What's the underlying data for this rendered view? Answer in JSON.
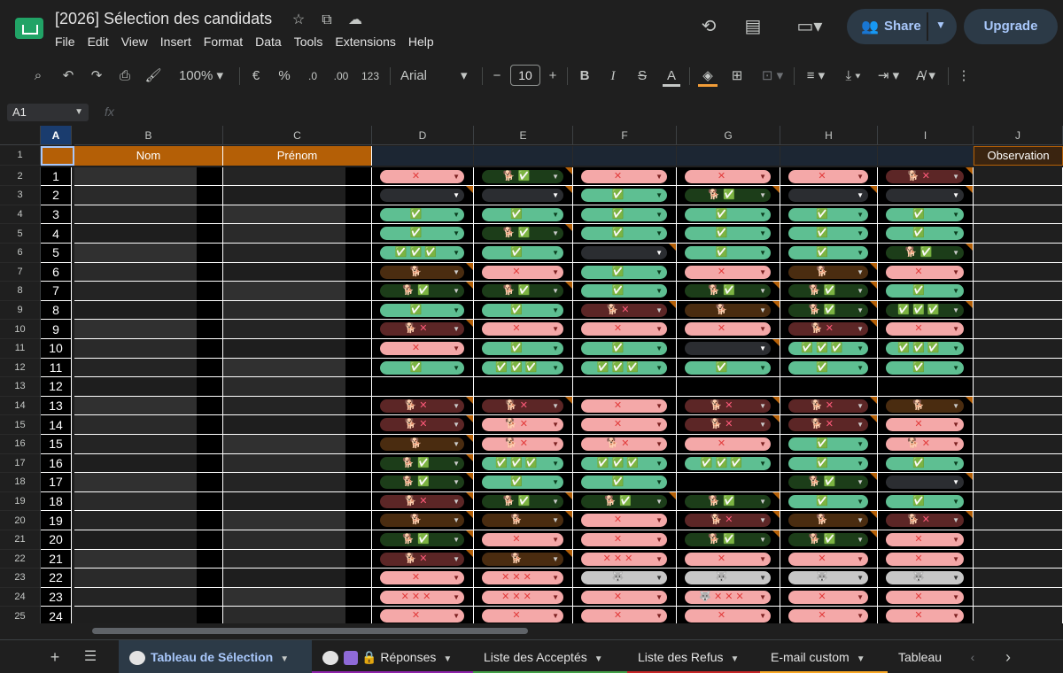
{
  "header": {
    "doc_title": "[2026] Sélection des candidats",
    "menu": [
      "File",
      "Edit",
      "View",
      "Insert",
      "Format",
      "Data",
      "Tools",
      "Extensions",
      "Help"
    ],
    "share_label": "Share",
    "upgrade_label": "Upgrade"
  },
  "toolbar": {
    "zoom": "100%",
    "currency": "€",
    "percent": "%",
    "dec_decrease": ".0",
    "dec_increase": ".00",
    "number_format": "123",
    "font_name": "Arial",
    "font_size": "10",
    "bold": "B",
    "italic": "I",
    "text_color_letter": "A"
  },
  "formula_bar": {
    "name_box": "A1",
    "fx": "fx",
    "content": ""
  },
  "columns": [
    "A",
    "B",
    "C",
    "D",
    "E",
    "F",
    "G",
    "H",
    "I",
    "J"
  ],
  "header_row": {
    "row_number": "1",
    "nom": "Nom",
    "prenom": "Prénom",
    "observation": "Observation"
  },
  "legend": {
    "G": "✓ (green chip)",
    "P": "✗ (pink chip)",
    "D": "dark green chip",
    "B": "brown chip",
    "M": "maroon chip",
    "K": "empty dark chip",
    "W": "grey chip"
  },
  "rows": [
    {
      "row": "2",
      "a": "1",
      "d": {
        "t": "P",
        "v": "✕"
      },
      "e": {
        "t": "D",
        "v": "🐕 ✅"
      },
      "f": {
        "t": "P",
        "v": "✕"
      },
      "g": {
        "t": "P",
        "v": "✕"
      },
      "h": {
        "t": "P",
        "v": "✕"
      },
      "i": {
        "t": "M",
        "v": "🐕 ✕"
      }
    },
    {
      "row": "3",
      "a": "2",
      "d": {
        "t": "K",
        "v": ""
      },
      "e": {
        "t": "K",
        "v": ""
      },
      "f": {
        "t": "G",
        "v": "✅"
      },
      "g": {
        "t": "D",
        "v": "🐕 ✅"
      },
      "h": {
        "t": "K",
        "v": ""
      },
      "i": {
        "t": "K",
        "v": ""
      }
    },
    {
      "row": "4",
      "a": "3",
      "d": {
        "t": "G",
        "v": "✅"
      },
      "e": {
        "t": "G",
        "v": "✅"
      },
      "f": {
        "t": "G",
        "v": "✅"
      },
      "g": {
        "t": "G",
        "v": "✅"
      },
      "h": {
        "t": "G",
        "v": "✅"
      },
      "i": {
        "t": "G",
        "v": "✅"
      }
    },
    {
      "row": "5",
      "a": "4",
      "d": {
        "t": "G",
        "v": "✅"
      },
      "e": {
        "t": "D",
        "v": "🐕 ✅"
      },
      "f": {
        "t": "G",
        "v": "✅"
      },
      "g": {
        "t": "G",
        "v": "✅"
      },
      "h": {
        "t": "G",
        "v": "✅"
      },
      "i": {
        "t": "G",
        "v": "✅"
      }
    },
    {
      "row": "6",
      "a": "5",
      "d": {
        "t": "G",
        "v": "✅ ✅ ✅"
      },
      "e": {
        "t": "G",
        "v": "✅"
      },
      "f": {
        "t": "K",
        "v": ""
      },
      "g": {
        "t": "G",
        "v": "✅"
      },
      "h": {
        "t": "G",
        "v": "✅"
      },
      "i": {
        "t": "D",
        "v": "🐕 ✅"
      }
    },
    {
      "row": "7",
      "a": "6",
      "d": {
        "t": "B",
        "v": "🐕"
      },
      "e": {
        "t": "P",
        "v": "✕"
      },
      "f": {
        "t": "G",
        "v": "✅"
      },
      "g": {
        "t": "P",
        "v": "✕"
      },
      "h": {
        "t": "B",
        "v": "🐕"
      },
      "i": {
        "t": "P",
        "v": "✕"
      }
    },
    {
      "row": "8",
      "a": "7",
      "d": {
        "t": "D",
        "v": "🐕 ✅"
      },
      "e": {
        "t": "D",
        "v": "🐕 ✅"
      },
      "f": {
        "t": "G",
        "v": "✅"
      },
      "g": {
        "t": "D",
        "v": "🐕 ✅"
      },
      "h": {
        "t": "D",
        "v": "🐕 ✅"
      },
      "i": {
        "t": "G",
        "v": "✅"
      }
    },
    {
      "row": "9",
      "a": "8",
      "d": {
        "t": "G",
        "v": "✅"
      },
      "e": {
        "t": "G",
        "v": "✅"
      },
      "f": {
        "t": "M",
        "v": "🐕 ✕"
      },
      "g": {
        "t": "B",
        "v": "🐕"
      },
      "h": {
        "t": "D",
        "v": "🐕 ✅"
      },
      "i": {
        "t": "D",
        "v": "✅ ✅ ✅"
      }
    },
    {
      "row": "10",
      "a": "9",
      "d": {
        "t": "M",
        "v": "🐕 ✕"
      },
      "e": {
        "t": "P",
        "v": "✕"
      },
      "f": {
        "t": "P",
        "v": "✕"
      },
      "g": {
        "t": "P",
        "v": "✕"
      },
      "h": {
        "t": "M",
        "v": "🐕 ✕"
      },
      "i": {
        "t": "P",
        "v": "✕"
      }
    },
    {
      "row": "11",
      "a": "10",
      "d": {
        "t": "P",
        "v": "✕"
      },
      "e": {
        "t": "G",
        "v": "✅"
      },
      "f": {
        "t": "G",
        "v": "✅"
      },
      "g": {
        "t": "K",
        "v": ""
      },
      "h": {
        "t": "G",
        "v": "✅ ✅ ✅"
      },
      "i": {
        "t": "G",
        "v": "✅ ✅ ✅"
      }
    },
    {
      "row": "12",
      "a": "11",
      "d": {
        "t": "G",
        "v": "✅"
      },
      "e": {
        "t": "G",
        "v": "✅ ✅ ✅"
      },
      "f": {
        "t": "G",
        "v": "✅ ✅ ✅"
      },
      "g": {
        "t": "G",
        "v": "✅"
      },
      "h": {
        "t": "G",
        "v": "✅"
      },
      "i": {
        "t": "G",
        "v": "✅"
      }
    },
    {
      "row": "13",
      "a": "12",
      "d": null,
      "e": null,
      "f": null,
      "g": null,
      "h": null,
      "i": null
    },
    {
      "row": "14",
      "a": "13",
      "d": {
        "t": "M",
        "v": "🐕 ✕"
      },
      "e": {
        "t": "M",
        "v": "🐕 ✕"
      },
      "f": {
        "t": "P",
        "v": "✕"
      },
      "g": {
        "t": "M",
        "v": "🐕 ✕"
      },
      "h": {
        "t": "M",
        "v": "🐕 ✕"
      },
      "i": {
        "t": "B",
        "v": "🐕"
      }
    },
    {
      "row": "15",
      "a": "14",
      "d": {
        "t": "M",
        "v": "🐕 ✕"
      },
      "e": {
        "t": "P",
        "v": "🐕 ✕"
      },
      "f": {
        "t": "P",
        "v": "✕"
      },
      "g": {
        "t": "M",
        "v": "🐕 ✕"
      },
      "h": {
        "t": "M",
        "v": "🐕 ✕"
      },
      "i": {
        "t": "P",
        "v": "✕"
      }
    },
    {
      "row": "16",
      "a": "15",
      "d": {
        "t": "B",
        "v": "🐕"
      },
      "e": {
        "t": "P",
        "v": "🐕 ✕"
      },
      "f": {
        "t": "P",
        "v": "🐕 ✕"
      },
      "g": {
        "t": "P",
        "v": "✕"
      },
      "h": {
        "t": "G",
        "v": "✅"
      },
      "i": {
        "t": "P",
        "v": "🐕 ✕"
      }
    },
    {
      "row": "17",
      "a": "16",
      "d": {
        "t": "D",
        "v": "🐕 ✅"
      },
      "e": {
        "t": "G",
        "v": "✅ ✅ ✅"
      },
      "f": {
        "t": "G",
        "v": "✅ ✅ ✅"
      },
      "g": {
        "t": "G",
        "v": "✅ ✅ ✅"
      },
      "h": {
        "t": "G",
        "v": "✅"
      },
      "i": {
        "t": "G",
        "v": "✅"
      }
    },
    {
      "row": "18",
      "a": "17",
      "d": {
        "t": "D",
        "v": "🐕 ✅"
      },
      "e": {
        "t": "G",
        "v": "✅"
      },
      "f": {
        "t": "G",
        "v": "✅"
      },
      "g": null,
      "h": {
        "t": "D",
        "v": "🐕 ✅"
      },
      "i": {
        "t": "K",
        "v": ""
      }
    },
    {
      "row": "19",
      "a": "18",
      "d": {
        "t": "M",
        "v": "🐕 ✕"
      },
      "e": {
        "t": "D",
        "v": "🐕 ✅"
      },
      "f": {
        "t": "D",
        "v": "🐕 ✅"
      },
      "g": {
        "t": "D",
        "v": "🐕 ✅"
      },
      "h": {
        "t": "G",
        "v": "✅"
      },
      "i": {
        "t": "G",
        "v": "✅"
      }
    },
    {
      "row": "20",
      "a": "19",
      "d": {
        "t": "B",
        "v": "🐕"
      },
      "e": {
        "t": "B",
        "v": "🐕"
      },
      "f": {
        "t": "P",
        "v": "✕"
      },
      "g": {
        "t": "M",
        "v": "🐕 ✕"
      },
      "h": {
        "t": "B",
        "v": "🐕"
      },
      "i": {
        "t": "M",
        "v": "🐕 ✕"
      }
    },
    {
      "row": "21",
      "a": "20",
      "d": {
        "t": "D",
        "v": "🐕 ✅"
      },
      "e": {
        "t": "P",
        "v": "✕"
      },
      "f": {
        "t": "P",
        "v": "✕"
      },
      "g": {
        "t": "D",
        "v": "🐕 ✅"
      },
      "h": {
        "t": "D",
        "v": "🐕 ✅"
      },
      "i": {
        "t": "P",
        "v": "✕"
      }
    },
    {
      "row": "22",
      "a": "21",
      "d": {
        "t": "M",
        "v": "🐕 ✕"
      },
      "e": {
        "t": "B",
        "v": "🐕"
      },
      "f": {
        "t": "P",
        "v": "✕ ✕ ✕"
      },
      "g": {
        "t": "P",
        "v": "✕"
      },
      "h": {
        "t": "P",
        "v": "✕"
      },
      "i": {
        "t": "P",
        "v": "✕"
      }
    },
    {
      "row": "23",
      "a": "22",
      "d": {
        "t": "P",
        "v": "✕"
      },
      "e": {
        "t": "P",
        "v": "✕ ✕ ✕"
      },
      "f": {
        "t": "W",
        "v": "🐺"
      },
      "g": {
        "t": "W",
        "v": "🐺"
      },
      "h": {
        "t": "W",
        "v": "🐺"
      },
      "i": {
        "t": "W",
        "v": "🐺"
      }
    },
    {
      "row": "24",
      "a": "23",
      "d": {
        "t": "P",
        "v": "✕ ✕ ✕"
      },
      "e": {
        "t": "P",
        "v": "✕ ✕ ✕"
      },
      "f": {
        "t": "P",
        "v": "✕"
      },
      "g": {
        "t": "P",
        "v": "🐺 ✕ ✕ ✕"
      },
      "h": {
        "t": "P",
        "v": "✕"
      },
      "i": {
        "t": "P",
        "v": "✕"
      }
    },
    {
      "row": "25",
      "a": "24",
      "d": {
        "t": "P",
        "v": "✕"
      },
      "e": {
        "t": "P",
        "v": "✕"
      },
      "f": {
        "t": "P",
        "v": "✕"
      },
      "g": {
        "t": "P",
        "v": "✕"
      },
      "h": {
        "t": "P",
        "v": "✕"
      },
      "i": {
        "t": "P",
        "v": "✕"
      }
    }
  ],
  "sheet_tabs": [
    {
      "label": "Tableau de Sélection",
      "active": true,
      "color": "#a8c7fa"
    },
    {
      "label": "Réponses",
      "active": false,
      "color": "#8e24aa"
    },
    {
      "label": "Liste des Acceptés",
      "active": false,
      "color": "#43a047"
    },
    {
      "label": "Liste des Refus",
      "active": false,
      "color": "#c62828"
    },
    {
      "label": "E-mail custom",
      "active": false,
      "color": "#f9a825"
    },
    {
      "label": "Tableau",
      "active": false,
      "color": ""
    }
  ],
  "colors": {
    "header_orange": "#b45f06",
    "green_chip": "#5ebf92",
    "pink_chip": "#f4a8a8",
    "dark_green_chip": "#1c3d19",
    "brown_chip": "#4a2c10",
    "maroon_chip": "#5c2626",
    "grey_chip": "#c7c7c7",
    "accent_blue": "#a8c7fa"
  }
}
